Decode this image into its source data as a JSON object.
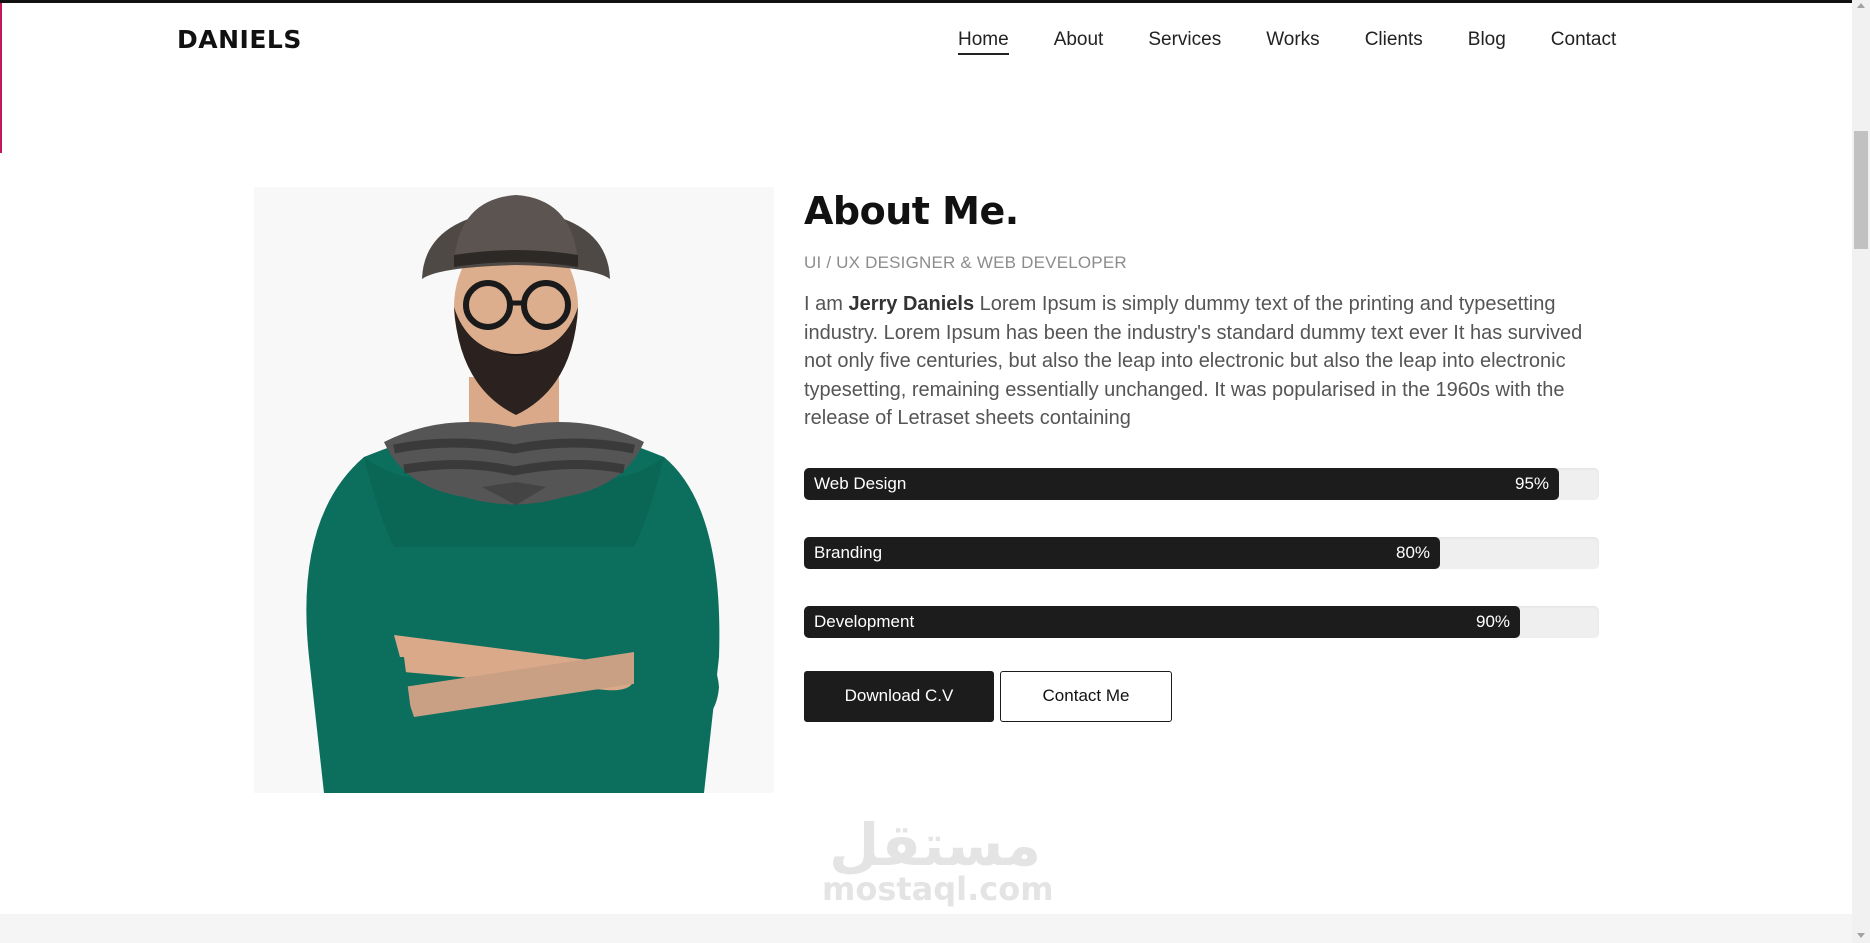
{
  "header": {
    "logo": "DANIELS",
    "nav": [
      "Home",
      "About",
      "Services",
      "Works",
      "Clients",
      "Blog",
      "Contact"
    ],
    "active": "Home"
  },
  "about": {
    "title": "About Me.",
    "subtitle": "UI / UX DESIGNER & WEB DEVELOPER",
    "intro_prefix": "I am ",
    "name": "Jerry Daniels",
    "intro_body": " Lorem Ipsum is simply dummy text of the printing and typesetting industry. Lorem Ipsum has been the industry's standard dummy text ever It has survived not only five centuries, but also the leap into electronic but also the leap into electronic typesetting, remaining essentially unchanged. It was popularised in the 1960s with the release of Letraset sheets containing"
  },
  "skills": [
    {
      "label": "Web Design",
      "percent_label": "95%",
      "value": 0.95
    },
    {
      "label": "Branding",
      "percent_label": "80%",
      "value": 0.8
    },
    {
      "label": "Development",
      "percent_label": "90%",
      "value": 0.9
    }
  ],
  "buttons": {
    "download": "Download C.V",
    "contact": "Contact Me"
  },
  "watermark": {
    "arabic": "مستقل",
    "latin": "mostaql.com"
  },
  "colors": {
    "accent_dark": "#1c1c1c",
    "text_muted": "#8c8c8c",
    "bar_track": "#efefef"
  }
}
